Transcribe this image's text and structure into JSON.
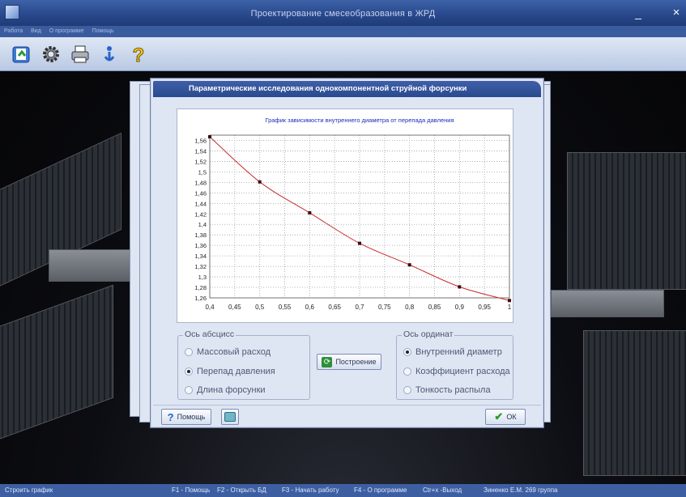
{
  "window": {
    "title": "Проектирование смесеобразования в ЖРД",
    "minimize": "_",
    "close": "×"
  },
  "menu": [
    "Работа",
    "Вид",
    "О программе",
    "Помощь"
  ],
  "toolbar": [
    {
      "icon": "open-db-icon"
    },
    {
      "icon": "gear-icon"
    },
    {
      "icon": "printer-icon"
    },
    {
      "icon": "info-icon"
    },
    {
      "icon": "help-icon"
    }
  ],
  "dialog": {
    "title": "Параметрические исследования однокомпонентной струйной форсунки",
    "x_axis_group": {
      "legend": "Ось абсцисс",
      "options": [
        {
          "label": "Массовый расход",
          "selected": false
        },
        {
          "label": "Перепад давления",
          "selected": true
        },
        {
          "label": "Длина форсунки",
          "selected": false
        }
      ]
    },
    "y_axis_group": {
      "legend": "Ось ординат",
      "options": [
        {
          "label": "Внутренний диаметр",
          "selected": true
        },
        {
          "label": "Коэффициент расхода",
          "selected": false
        },
        {
          "label": "Тонкость распыла",
          "selected": false
        }
      ]
    },
    "build_button": "Построение",
    "help_button": "Помощь",
    "ok_button": "ОК"
  },
  "chart_data": {
    "type": "line",
    "title": "График зависимости внутреннего диаметра от перепада давления",
    "xlabel": "",
    "ylabel": "",
    "xlim": [
      0.4,
      1
    ],
    "ylim": [
      1.26,
      1.57
    ],
    "x_ticks": [
      "0,4",
      "0,45",
      "0,5",
      "0,55",
      "0,6",
      "0,65",
      "0,7",
      "0,75",
      "0,8",
      "0,85",
      "0,9",
      "0,95",
      "1"
    ],
    "y_ticks": [
      "1,26",
      "1,28",
      "1,3",
      "1,32",
      "1,34",
      "1,36",
      "1,38",
      "1,4",
      "1,42",
      "1,44",
      "1,46",
      "1,48",
      "1,5",
      "1,52",
      "1,54",
      "1,56"
    ],
    "grid": true,
    "series": [
      {
        "x": [
          0.4,
          0.5,
          0.6,
          0.7,
          0.8,
          0.9,
          1.0
        ],
        "y": [
          1.567,
          1.481,
          1.422,
          1.364,
          1.323,
          1.281,
          1.255
        ],
        "color": "#cc2b2b"
      }
    ]
  },
  "status": {
    "hint": "Строить график",
    "f1": "F1 - Помощь",
    "f2": "F2 - Открыть БД",
    "f3": "F3 - Начать работу",
    "f4": "F4 - О программе",
    "exit": "Ctr+x -Выход",
    "author": "Зиненко Е.М. 269 группа"
  }
}
